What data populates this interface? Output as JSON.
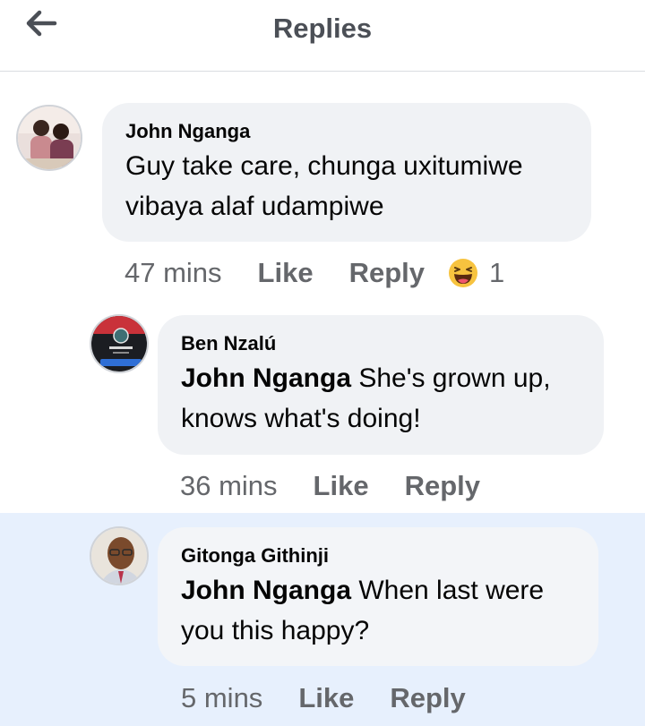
{
  "header": {
    "title": "Replies",
    "back_icon": "arrow-left-icon"
  },
  "comments": [
    {
      "author": "John Nganga",
      "text": "Guy take care, chunga uxitumiwe vibaya alaf udampiwe",
      "time": "47 mins",
      "like_label": "Like",
      "reply_label": "Reply",
      "reaction_icon": "haha-emoji-icon",
      "reaction_count": "1"
    },
    {
      "author": "Ben Nzalú",
      "mention": "John Nganga",
      "text": " She's grown up, knows what's doing!",
      "time": "36 mins",
      "like_label": "Like",
      "reply_label": "Reply"
    },
    {
      "author": "Gitonga Githinji",
      "mention": "John Nganga",
      "text": " When last were you this happy?",
      "time": "5 mins",
      "like_label": "Like",
      "reply_label": "Reply"
    }
  ],
  "colors": {
    "bubble": "#f0f2f5",
    "highlight": "#e7f0fd",
    "meta_text": "#65676b",
    "title": "#4b4f56"
  }
}
